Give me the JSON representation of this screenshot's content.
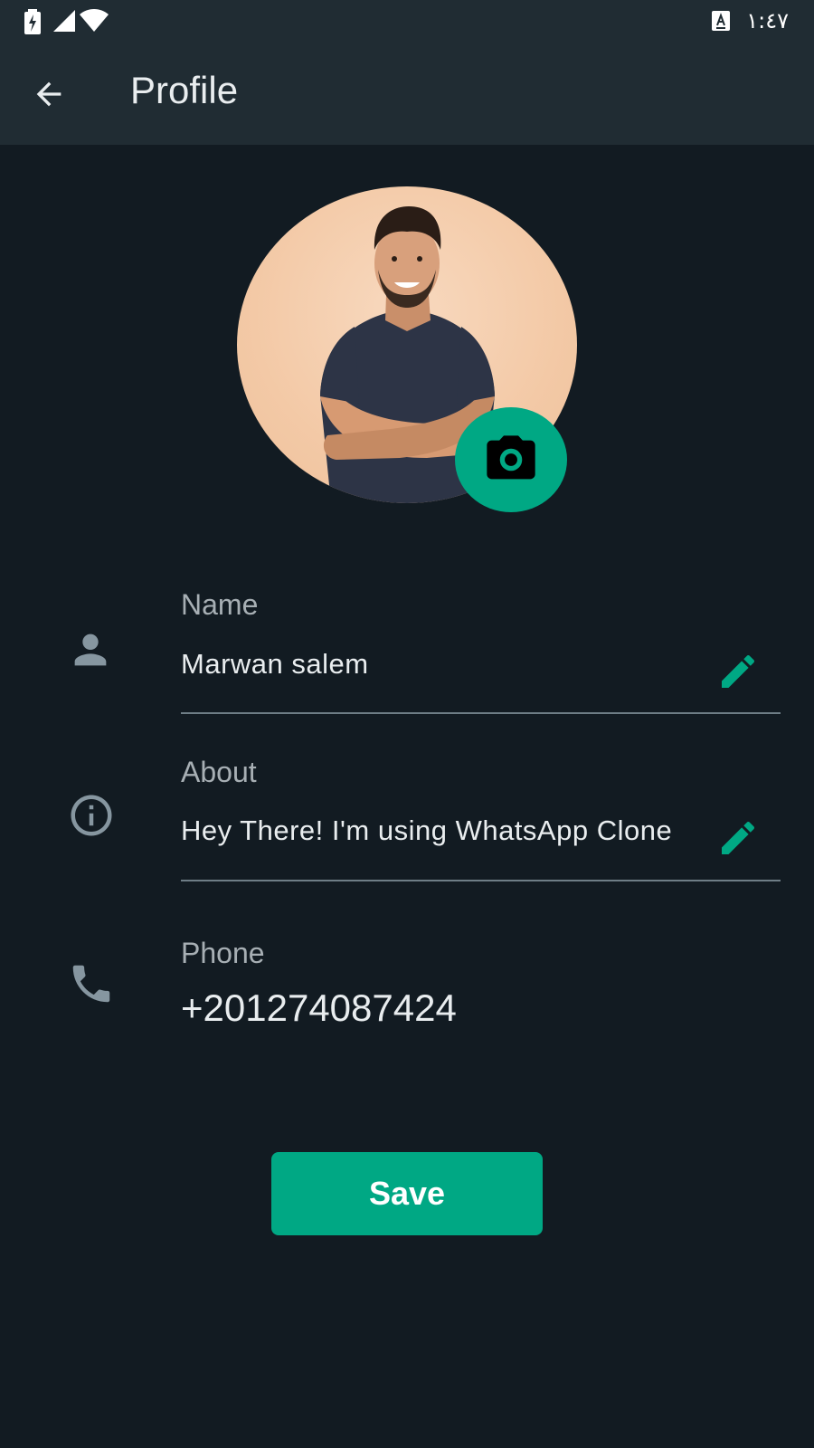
{
  "status_bar": {
    "time": "١:٤٧",
    "icons": [
      "battery-charging-icon",
      "cell-signal-icon",
      "wifi-icon",
      "keyboard-input-icon"
    ]
  },
  "app_bar": {
    "title": "Profile",
    "back_icon": "arrow-back-icon"
  },
  "profile": {
    "avatar_icon": "profile-photo",
    "camera_icon": "camera-icon",
    "fields": {
      "name": {
        "label": "Name",
        "value": "Marwan salem",
        "icon": "person-icon",
        "edit_icon": "pencil-icon"
      },
      "about": {
        "label": "About",
        "value": "Hey There! I'm using WhatsApp Clone",
        "icon": "info-icon",
        "edit_icon": "pencil-icon"
      },
      "phone": {
        "label": "Phone",
        "value": "+201274087424",
        "icon": "phone-icon"
      }
    }
  },
  "actions": {
    "save_label": "Save"
  },
  "colors": {
    "background": "#121b22",
    "app_bar": "#202c33",
    "accent": "#00a884",
    "text_primary": "#e9edef",
    "text_secondary": "#a7afb4",
    "divider": "#8696a0"
  }
}
